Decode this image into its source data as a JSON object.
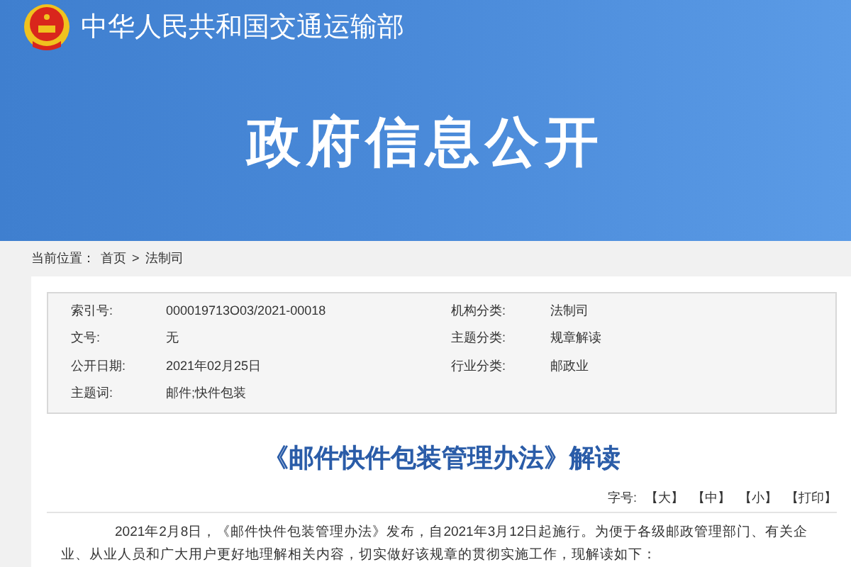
{
  "header": {
    "ministry": "中华人民共和国交通运输部",
    "banner_title": "政府信息公开"
  },
  "breadcrumb": {
    "label": "当前位置：",
    "items": [
      {
        "text": "首页"
      },
      {
        "text": "法制司"
      }
    ],
    "separator": ">"
  },
  "meta": [
    {
      "label": "索引号:",
      "value": "000019713O03/2021-00018"
    },
    {
      "label": "机构分类:",
      "value": "法制司"
    },
    {
      "label": "文号:",
      "value": "无"
    },
    {
      "label": "主题分类:",
      "value": "规章解读"
    },
    {
      "label": "公开日期:",
      "value": "2021年02月25日"
    },
    {
      "label": "行业分类:",
      "value": "邮政业"
    },
    {
      "label": "主题词:",
      "value": "邮件;快件包装"
    }
  ],
  "article": {
    "title": "《邮件快件包装管理办法》解读",
    "font_size_label": "字号:",
    "tools": [
      "【大】",
      "【中】",
      "【小】",
      "【打印】"
    ],
    "paragraph": "2021年2月8日，《邮件快件包装管理办法》发布，自2021年3月12日起施行。为便于各级邮政管理部门、有关企业、从业人员和广大用户更好地理解相关内容，切实做好该规章的贯彻实施工作，现解读如下："
  }
}
